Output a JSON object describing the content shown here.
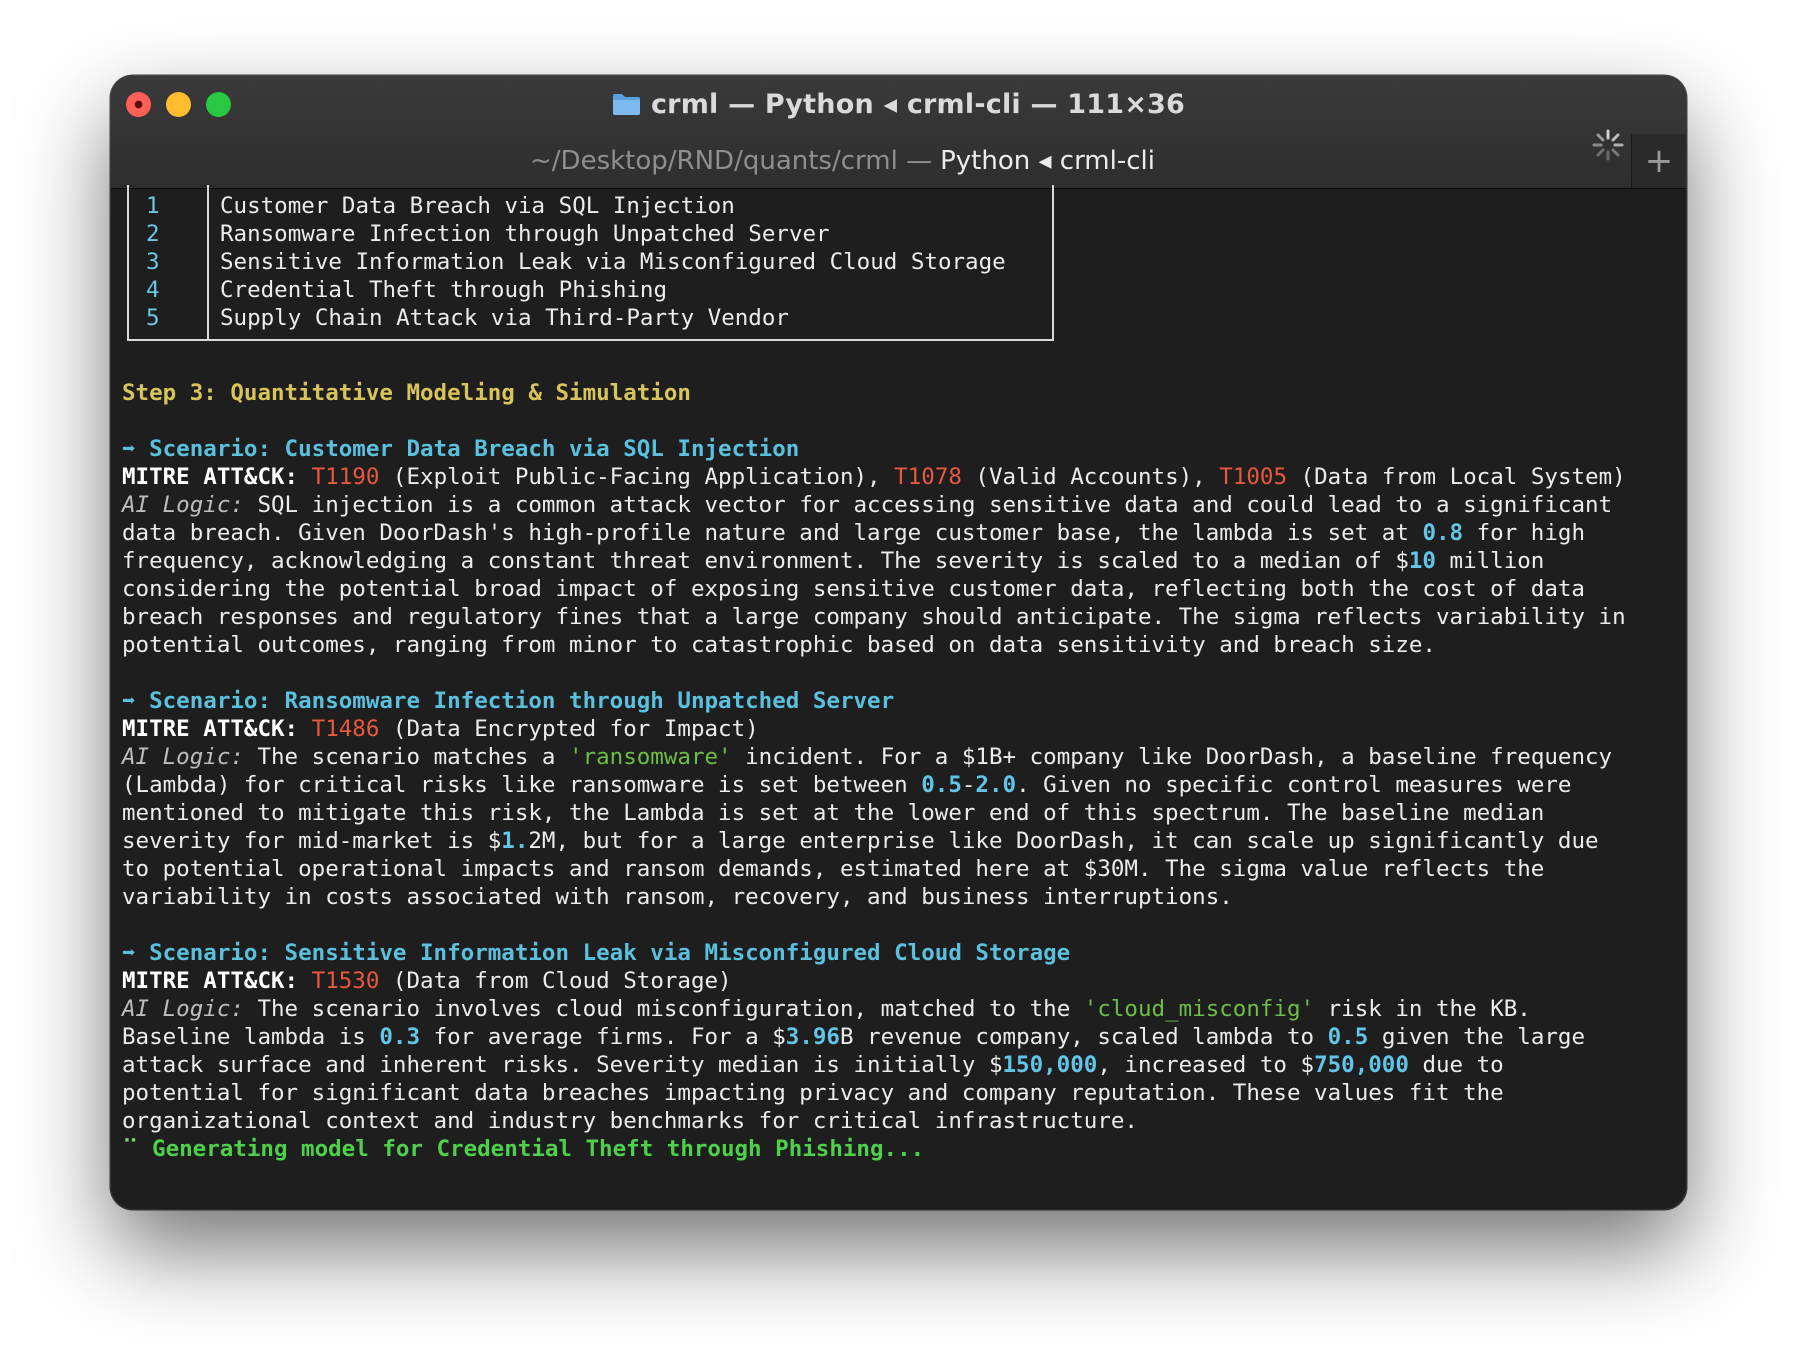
{
  "window": {
    "title": "crml — Python ◂ crml-cli — 111×36",
    "tab_path": "~/Desktop/RND/quants/crml —",
    "tab_process": "Python ◂ crml-cli",
    "new_tab": "+"
  },
  "table": {
    "rows": [
      {
        "num": "1",
        "name": "Customer Data Breach via SQL Injection"
      },
      {
        "num": "2",
        "name": "Ransomware Infection through Unpatched Server"
      },
      {
        "num": "3",
        "name": "Sensitive Information Leak via Misconfigured Cloud Storage"
      },
      {
        "num": "4",
        "name": "Credential Theft through Phishing"
      },
      {
        "num": "5",
        "name": "Supply Chain Attack via Third-Party Vendor"
      }
    ]
  },
  "step_heading": "Step 3: Quantitative Modeling & Simulation",
  "mitre_label": "MITRE ATT&CK:",
  "ai_label": "AI Logic:",
  "scenarios": [
    {
      "heading": "➡ Scenario: Customer Data Breach via SQL Injection",
      "t1": "T1190",
      "t1_desc": " (Exploit Public-Facing Application), ",
      "t2": "T1078",
      "t2_desc": " (Valid Accounts), ",
      "t3": "T1005",
      "t3_desc": " (Data from Local System)",
      "l1": " SQL injection is a common attack vector for accessing sensitive data and could lead to a significant",
      "l2a": "data breach. Given DoorDash's high-profile nature and large customer base, the lambda is set at ",
      "l2n": "0.8",
      "l2b": " for high",
      "l3a": "frequency, acknowledging a constant threat environment. The severity is scaled to a median of $",
      "l3n": "10",
      "l3b": " million",
      "l4": "considering the potential broad impact of exposing sensitive customer data, reflecting both the cost of data",
      "l5": "breach responses and regulatory fines that a large company should anticipate. The sigma reflects variability in",
      "l6": "potential outcomes, ranging from minor to catastrophic based on data sensitivity and breach size."
    },
    {
      "heading": "➡ Scenario: Ransomware Infection through Unpatched Server",
      "t1": "T1486",
      "t1_desc": " (Data Encrypted for Impact)",
      "l1a": " The scenario matches a ",
      "l1g": "'ransomware'",
      "l1b": " incident. For a $1B+ company like DoorDash, a baseline frequency",
      "l2a": "(Lambda) for critical risks like ransomware is set between ",
      "l2n1": "0.5",
      "l2d": "-",
      "l2n2": "2.0",
      "l2b": ". Given no specific control measures were",
      "l3": "mentioned to mitigate this risk, the Lambda is set at the lower end of this spectrum. The baseline median",
      "l4a": "severity for mid-market is $",
      "l4n": "1.",
      "l4b": "2M, but for a large enterprise like DoorDash, it can scale up significantly due",
      "l5": "to potential operational impacts and ransom demands, estimated here at $30M. The sigma value reflects the",
      "l6": "variability in costs associated with ransom, recovery, and business interruptions."
    },
    {
      "heading": "➡ Scenario: Sensitive Information Leak via Misconfigured Cloud Storage",
      "t1": "T1530",
      "t1_desc": " (Data from Cloud Storage)",
      "l1a": " The scenario involves cloud misconfiguration, matched to the ",
      "l1g": "'cloud_misconfig'",
      "l1b": " risk in the KB.",
      "l2a": "Baseline lambda is ",
      "l2n1": "0.3",
      "l2b": " for average firms. For a $",
      "l2n2": "3.96",
      "l2c": "B revenue company, scaled lambda to ",
      "l2n3": "0.5",
      "l2d": " given the large",
      "l3a": "attack surface and inherent risks. Severity median is initially $",
      "l3n1": "150,000",
      "l3b": ", increased to $",
      "l3n2": "750,000",
      "l3c": " due to",
      "l4": "potential for significant data breaches impacting privacy and company reputation. These values fit the",
      "l5": "organizational context and industry benchmarks for critical infrastructure."
    }
  ],
  "status": {
    "spinner": "⠉",
    "text": " Generating model for Credential Theft through Phishing..."
  }
}
